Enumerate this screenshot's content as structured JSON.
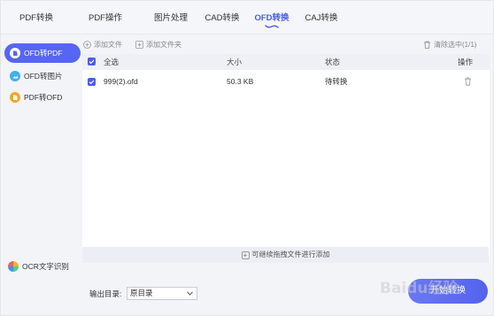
{
  "nav": {
    "tabs": [
      {
        "label": "PDF转换"
      },
      {
        "label": "PDF操作"
      },
      {
        "label": "图片处理"
      },
      {
        "label": "CAD转换"
      },
      {
        "label": "OFD转换"
      },
      {
        "label": "CAJ转换"
      }
    ],
    "active_tab": "OFD转换"
  },
  "sidebar": {
    "items": [
      {
        "label": "OFD转PDF",
        "active": true
      },
      {
        "label": "OFD转图片",
        "active": false
      },
      {
        "label": "PDF转OFD",
        "active": false
      }
    ],
    "ocr_label": "OCR文字识别"
  },
  "toolbar": {
    "add_file": "添加文件",
    "add_folder": "添加文件夹",
    "clear_selected": "清除选中(1/1)"
  },
  "table": {
    "headers": {
      "select_all": "全选",
      "size": "大小",
      "status": "状态",
      "action": "操作"
    },
    "rows": [
      {
        "name": "999(2).ofd",
        "size": "50.3 KB",
        "status": "待转换"
      }
    ]
  },
  "drop_hint": "可继续拖拽文件进行添加",
  "output": {
    "label": "输出目录:",
    "selected": "原目录"
  },
  "start_button": "开始转换",
  "watermark": "Baidu经验",
  "colors": {
    "accent": "#5665f3",
    "active_tab": "#4a5bf0"
  }
}
